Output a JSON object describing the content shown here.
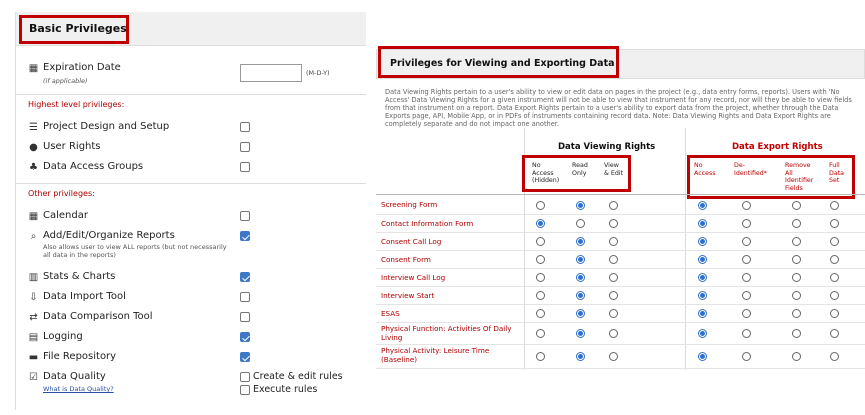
{
  "basic": {
    "title": "Basic Privileges",
    "expiration_label": "Expiration Date",
    "expiration_note": "(if applicable)",
    "expiration_value": "",
    "date_format": "(M-D-Y)",
    "highest_label": "Highest level privileges:",
    "other_label": "Other privileges:",
    "highest": [
      {
        "icon": "list-icon",
        "label": "Project Design and Setup",
        "checked": false
      },
      {
        "icon": "user-icon",
        "label": "User Rights",
        "checked": false
      },
      {
        "icon": "users-icon",
        "label": "Data Access Groups",
        "checked": false
      }
    ],
    "other": [
      {
        "icon": "calendar-icon",
        "label": "Calendar",
        "checked": false
      },
      {
        "icon": "search-icon",
        "label": "Add/Edit/Organize Reports",
        "sub": "Also allows user to view ALL reports (but not necessarily all data in the reports)",
        "checked": true
      },
      {
        "icon": "bar-chart-icon",
        "label": "Stats & Charts",
        "checked": true
      },
      {
        "icon": "import-icon",
        "label": "Data Import Tool",
        "checked": false
      },
      {
        "icon": "compare-icon",
        "label": "Data Comparison Tool",
        "checked": false
      },
      {
        "icon": "log-icon",
        "label": "Logging",
        "checked": true
      },
      {
        "icon": "folder-icon",
        "label": "File Repository",
        "checked": true
      }
    ],
    "data_quality": {
      "label": "Data Quality",
      "link": "What is Data Quality?",
      "options": [
        {
          "label": "Create & edit rules",
          "checked": false
        },
        {
          "label": "Execute rules",
          "checked": false
        }
      ]
    }
  },
  "viewing": {
    "title": "Privileges for Viewing and Exporting Data",
    "description": "Data Viewing Rights pertain to a user's ability to view or edit data on pages in the project (e.g., data entry forms, reports). Users with 'No Access' Data Viewing Rights for a given instrument will not be able to view that instrument for any record, nor will they be able to view fields from that instrument on a report. Data Export Rights pertain to a user's ability to export data from the project, whether through the Data Exports page, API, Mobile App, or in PDFs of instruments containing record data. Note: Data Viewing Rights and Data Export Rights are completely separate and do not impact one another.",
    "view_group": "Data Viewing Rights",
    "export_group": "Data Export Rights",
    "view_cols": [
      [
        "No",
        "Access",
        "(Hidden)"
      ],
      [
        "Read",
        "Only"
      ],
      [
        "View",
        "& Edit"
      ]
    ],
    "export_cols": [
      [
        "No",
        "Access"
      ],
      [
        "De-",
        "Identified*"
      ],
      [
        "Remove",
        "All",
        "Identifier",
        "Fields"
      ],
      [
        "Full",
        "Data",
        "Set"
      ]
    ],
    "instruments": [
      {
        "name": "Screening Form",
        "view": 1,
        "export": 0
      },
      {
        "name": "Contact Information Form",
        "view": 0,
        "export": 0
      },
      {
        "name": "Consent Call Log",
        "view": 1,
        "export": 0
      },
      {
        "name": "Consent Form",
        "view": 1,
        "export": 0
      },
      {
        "name": "Interview Call Log",
        "view": 1,
        "export": 0
      },
      {
        "name": "Interview Start",
        "view": 1,
        "export": 0
      },
      {
        "name": "ESAS",
        "view": 1,
        "export": 0
      },
      {
        "name": "Physical Function: Activities Of Daily Living",
        "view": 1,
        "export": 0
      },
      {
        "name": "Physical Activity: Leisure Time (Baseline)",
        "view": 1,
        "export": 0
      }
    ]
  },
  "colors": {
    "accent_red": "#c00000",
    "checked_blue": "#3d78c8",
    "radio_blue": "#2f6fd0"
  }
}
